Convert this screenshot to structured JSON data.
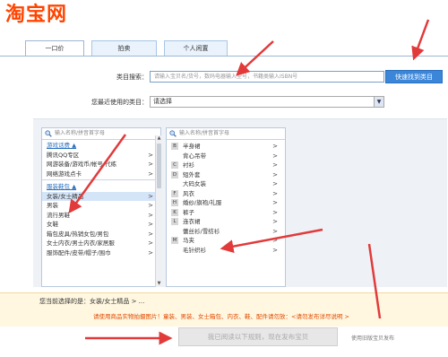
{
  "header": {
    "logo": "淘宝网"
  },
  "tabs": [
    {
      "label": "一口价",
      "active": true
    },
    {
      "label": "拍卖",
      "active": false
    },
    {
      "label": "个人闲置",
      "active": false
    }
  ],
  "search": {
    "label": "类目搜索：",
    "placeholder": "请输入宝贝名/货号，数码电器输入型号，书籍类输入ISBN号",
    "button": "快速找到类目"
  },
  "recent": {
    "label": "您最近使用的类目：",
    "value": "请选择"
  },
  "col1": {
    "search_placeholder": "输入名称/拼音首字母",
    "groups": [
      {
        "title": "游戏话费 ▲",
        "items": [
          "腾讯QQ专区",
          "网游装备/游戏币/帐号/代练",
          "网络游戏点卡"
        ]
      },
      {
        "title": "服装鞋包 ▲",
        "items": [
          "女装/女士精品",
          "男装",
          "流行男鞋",
          "女鞋",
          "箱包皮具/热销女包/男包",
          "女士内衣/男士内衣/家居服",
          "服饰配件/皮带/帽子/围巾"
        ]
      }
    ],
    "selected": "女装/女士精品"
  },
  "col2": {
    "search_placeholder": "输入名称/拼音首字母",
    "rows": [
      {
        "letter": "B",
        "text": "半身裙"
      },
      {
        "letter": "",
        "text": "背心吊带"
      },
      {
        "letter": "C",
        "text": "衬衫"
      },
      {
        "letter": "D",
        "text": "短外套"
      },
      {
        "letter": "",
        "text": "大码女装"
      },
      {
        "letter": "F",
        "text": "风衣"
      },
      {
        "letter": "H",
        "text": "婚纱/旗袍/礼服"
      },
      {
        "letter": "K",
        "text": "裤子"
      },
      {
        "letter": "L",
        "text": "连衣裙"
      },
      {
        "letter": "",
        "text": "蕾丝衫/雪纺衫"
      },
      {
        "letter": "M",
        "text": "马夹"
      },
      {
        "letter": "",
        "text": "毛针织衫"
      }
    ]
  },
  "footer": {
    "choice": "您当前选择的是：女装/女士精品 > ...",
    "notice": "请使用商品实物拍摄图片！童装、男装、女士箱包、内衣、鞋、配件请勿放：<请勿发布详尽说明  >",
    "publish": "我已阅读以下规则，现在发布宝贝",
    "old_link": "使用旧版宝贝发布"
  }
}
